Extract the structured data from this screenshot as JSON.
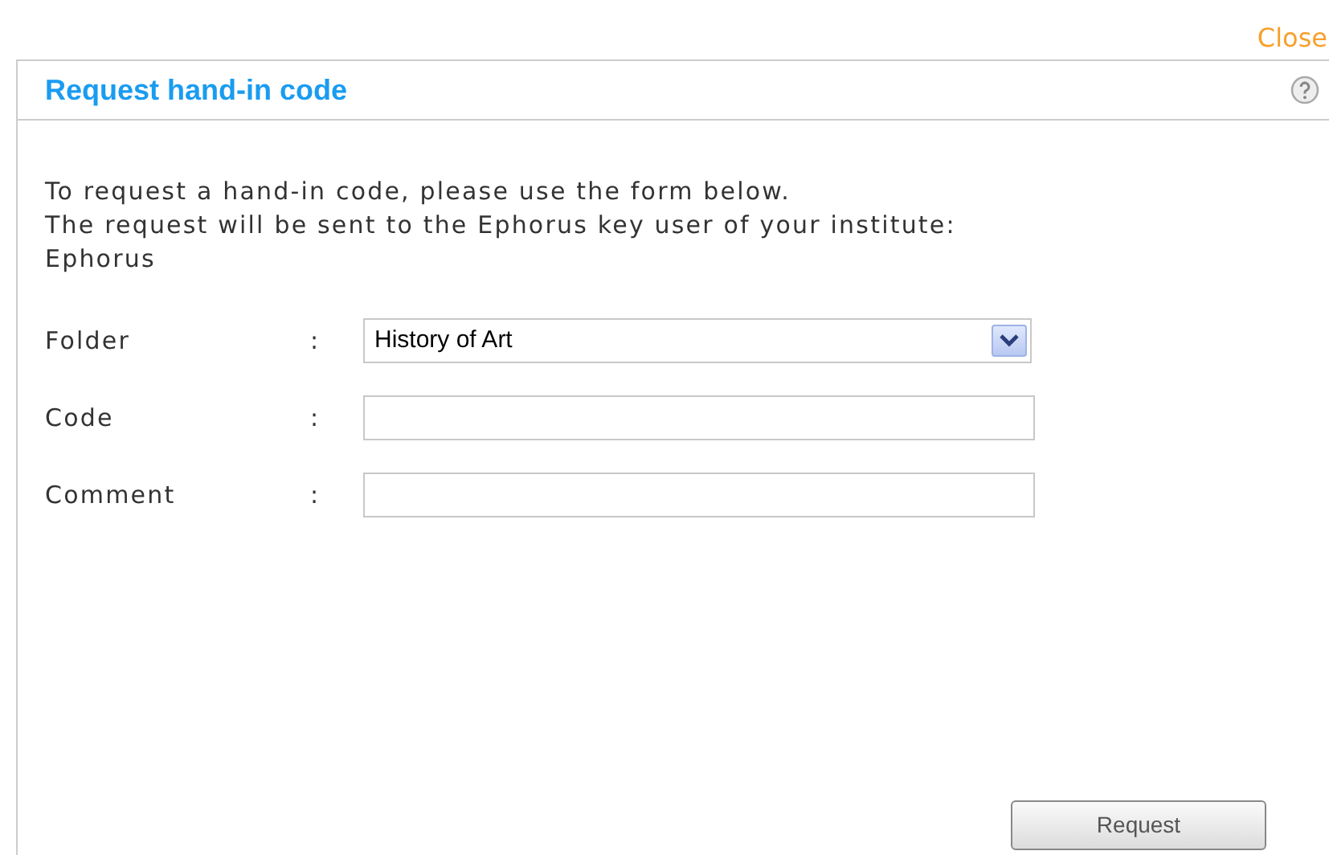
{
  "close_link": "Close",
  "dialog": {
    "title": "Request hand-in code",
    "intro_lines": [
      "To request a hand-in code, please use the form below.",
      "The request will be sent to the Ephorus key user of your institute:",
      "Ephorus"
    ],
    "fields": [
      {
        "kind": "select",
        "label": "Folder",
        "separator": ":",
        "value": "History of Art"
      },
      {
        "kind": "text",
        "label": "Code",
        "separator": ":"
      },
      {
        "kind": "text",
        "label": "Comment",
        "separator": ":"
      }
    ],
    "submit_button": "Request"
  }
}
